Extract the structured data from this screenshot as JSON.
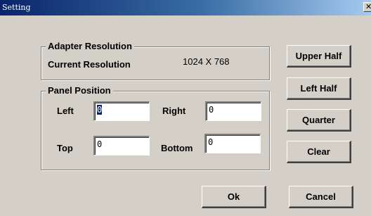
{
  "window": {
    "title": "Setting",
    "close_glyph": "✕"
  },
  "adapter": {
    "group_title": "Adapter Resolution",
    "current_label": "Current Resolution",
    "current_value": "1024 X 768"
  },
  "panel": {
    "group_title": "Panel Position",
    "left_label": "Left",
    "right_label": "Right",
    "top_label": "Top",
    "bottom_label": "Bottom",
    "left_value": "0",
    "right_value": "0",
    "top_value": "0",
    "bottom_value": "0"
  },
  "buttons": {
    "upper_half": "Upper Half",
    "left_half": "Left Half",
    "quarter": "Quarter",
    "clear": "Clear",
    "ok": "Ok",
    "cancel": "Cancel"
  },
  "colors": {
    "titlebar_start": "#0a246a",
    "titlebar_end": "#a6caf0",
    "face": "#d4d0c8"
  }
}
